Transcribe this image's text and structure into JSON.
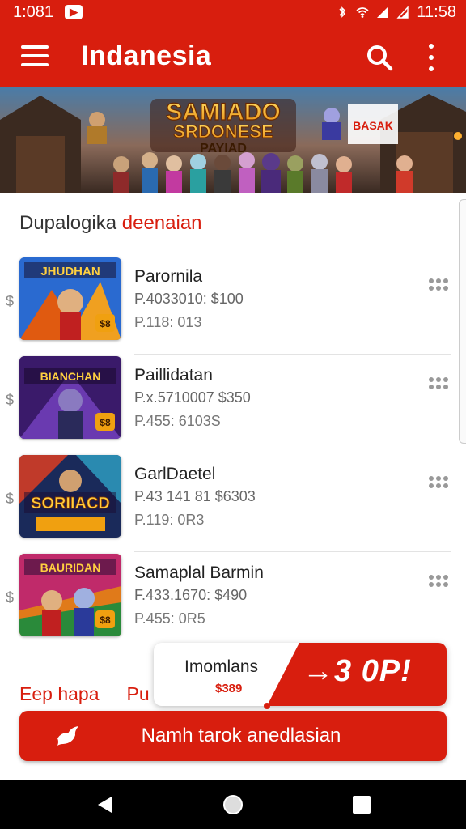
{
  "status_bar": {
    "time_left": "1:081",
    "time_right": "11:58"
  },
  "app_bar": {
    "title": "Indanesia"
  },
  "banner": {
    "title_line1": "SAMIADO",
    "title_line2": "SRDONESE",
    "title_line3": "PAYIAD",
    "side_text": "BASAK"
  },
  "section": {
    "title_main": "Dupalogika",
    "title_accent": "deenaian"
  },
  "items": [
    {
      "title": "Parornila",
      "price": "P.4033010: $100",
      "meta": "P.118: 013",
      "thumb_text": "JHUDHAN",
      "badge": "$8"
    },
    {
      "title": "Paillidatan",
      "price": "P.x.5710007 $350",
      "meta": "P.455: 6103S",
      "thumb_text": "BIANCHAN",
      "badge": "$8"
    },
    {
      "title": "GarlDaetel",
      "price": "P.43 141 81 $6303",
      "meta": "P.119: 0R3",
      "thumb_text": "SORIIACD",
      "badge": ""
    },
    {
      "title": "Samaplal Barmin",
      "price": "F.433.1670: $490",
      "meta": "P.455: 0R5",
      "thumb_text": "BAURIDAN",
      "badge": "$8"
    }
  ],
  "bottom_links": [
    "Eep hapa",
    "Pu"
  ],
  "promo": {
    "label": "Imomlans",
    "price": "$389",
    "cta": "→3 0P!"
  },
  "cta_button": {
    "label": "Namh tarok anedlasian"
  },
  "colors": {
    "brand": "#d81e0e",
    "text": "#222222",
    "muted": "#777777"
  }
}
